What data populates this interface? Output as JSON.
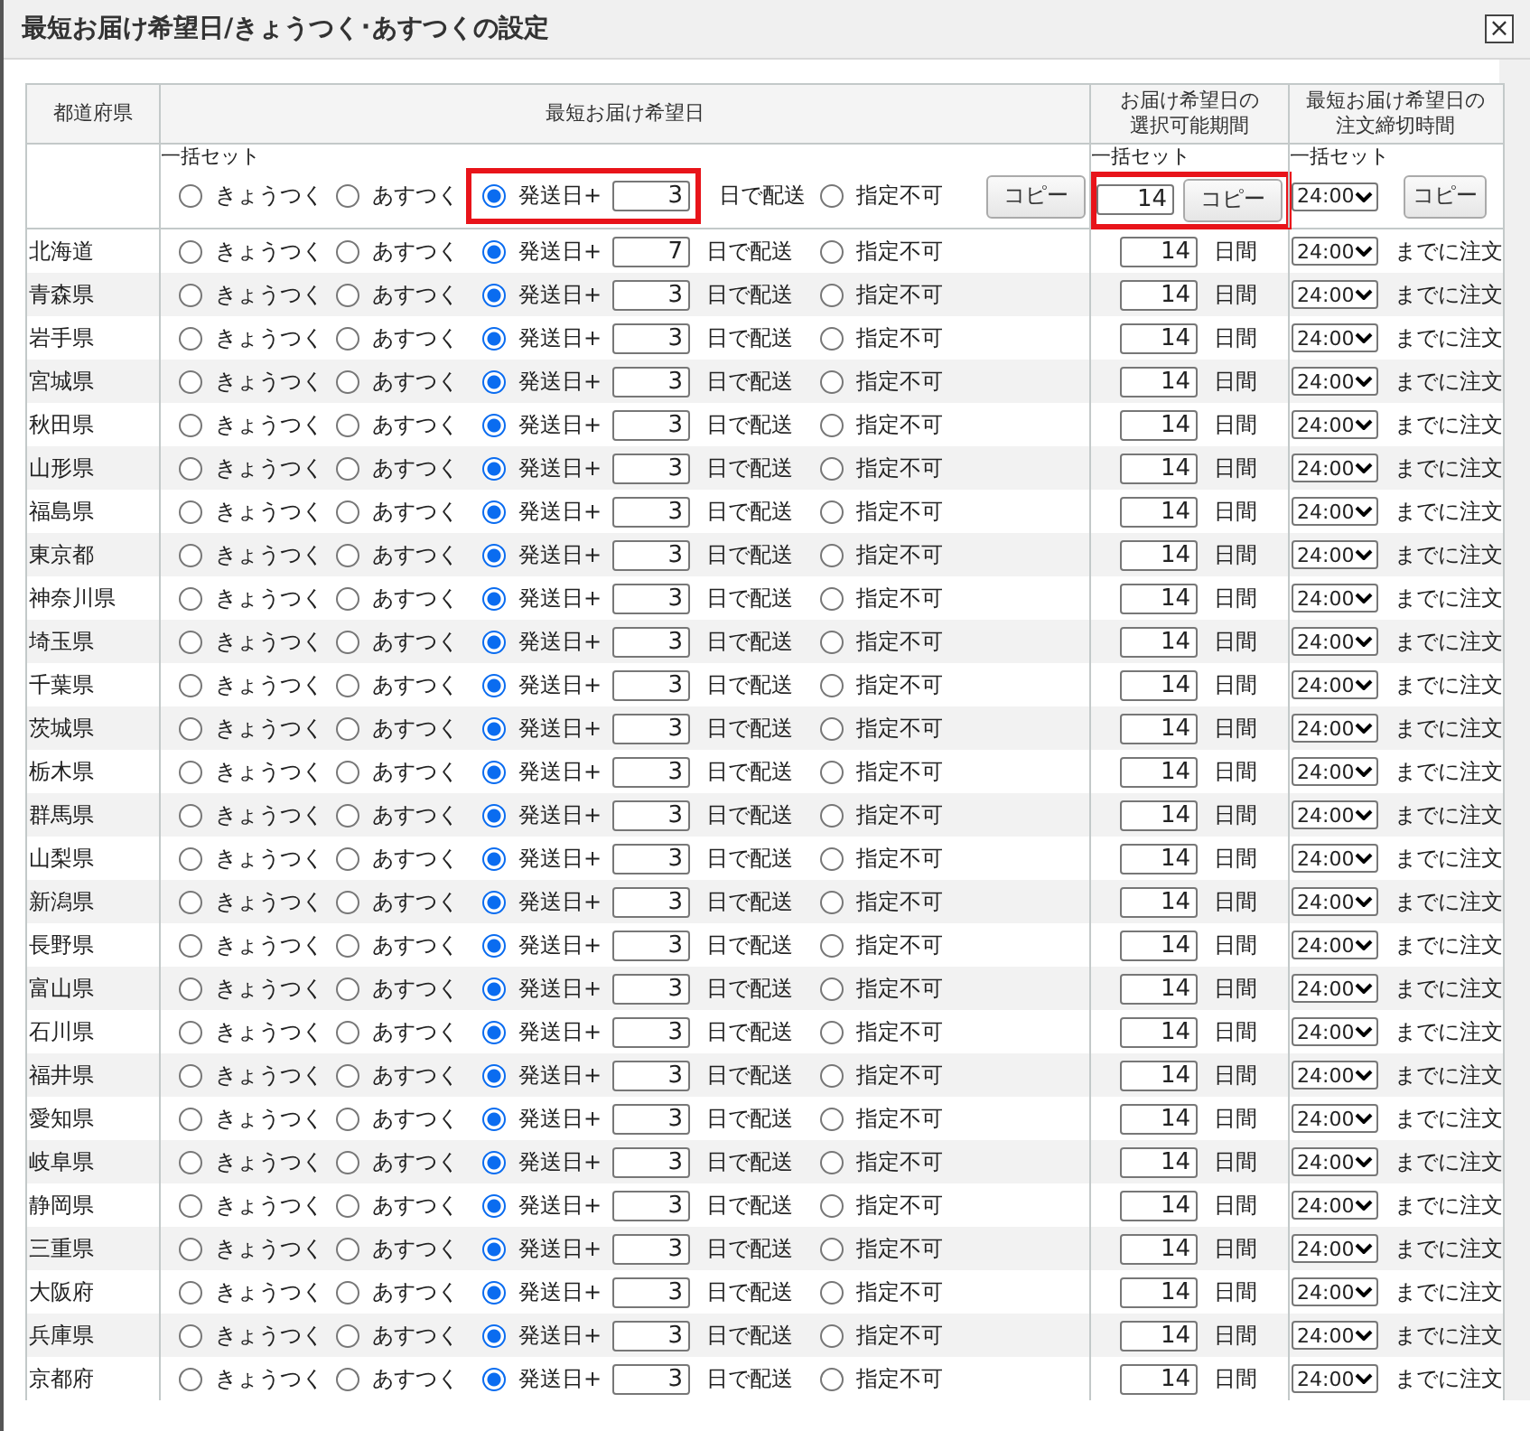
{
  "window": {
    "title": "最短お届け希望日/きょうつく･あすつくの設定",
    "close": "×"
  },
  "table": {
    "columns": [
      "都道府県",
      "最短お届け希望日",
      "お届け希望日の選択可能期間",
      "最短お届け希望日の注文締切時間"
    ],
    "bulk": {
      "label": "一括セット",
      "options": [
        {
          "label": "きょうつく",
          "selected": false
        },
        {
          "label": "あすつく",
          "selected": false
        },
        {
          "label": "発送日+",
          "selected": true,
          "highlighted": true
        },
        {
          "label": "指定不可",
          "selected": false
        }
      ],
      "days": "3",
      "days_unit": "日で配送",
      "copy": "コピー",
      "period_label": "一括セット",
      "period": "14",
      "period_copy": "コピー",
      "period_highlighted": true,
      "cutoff_label": "一括セット",
      "cutoff": "24:00",
      "cutoff_copy": "コピー"
    },
    "rows": [
      {
        "prefecture": "北海道",
        "options": [
          {
            "label": "きょうつく",
            "selected": false
          },
          {
            "label": "あすつく",
            "selected": false
          },
          {
            "label": "発送日+",
            "selected": true
          },
          {
            "label": "指定不可",
            "selected": false
          }
        ],
        "days": "7",
        "days_unit": "日で配送",
        "period": "14",
        "period_unit": "日間",
        "cutoff": "24:00",
        "cutoff_note": "までに注文"
      },
      {
        "prefecture": "青森県",
        "options": [
          {
            "label": "きょうつく",
            "selected": false
          },
          {
            "label": "あすつく",
            "selected": false
          },
          {
            "label": "発送日+",
            "selected": true
          },
          {
            "label": "指定不可",
            "selected": false
          }
        ],
        "days": "3",
        "days_unit": "日で配送",
        "period": "14",
        "period_unit": "日間",
        "cutoff": "24:00",
        "cutoff_note": "までに注文"
      },
      {
        "prefecture": "岩手県",
        "options": [
          {
            "label": "きょうつく",
            "selected": false
          },
          {
            "label": "あすつく",
            "selected": false
          },
          {
            "label": "発送日+",
            "selected": true
          },
          {
            "label": "指定不可",
            "selected": false
          }
        ],
        "days": "3",
        "days_unit": "日で配送",
        "period": "14",
        "period_unit": "日間",
        "cutoff": "24:00",
        "cutoff_note": "までに注文"
      },
      {
        "prefecture": "宮城県",
        "options": [
          {
            "label": "きょうつく",
            "selected": false
          },
          {
            "label": "あすつく",
            "selected": false
          },
          {
            "label": "発送日+",
            "selected": true
          },
          {
            "label": "指定不可",
            "selected": false
          }
        ],
        "days": "3",
        "days_unit": "日で配送",
        "period": "14",
        "period_unit": "日間",
        "cutoff": "24:00",
        "cutoff_note": "までに注文"
      },
      {
        "prefecture": "秋田県",
        "options": [
          {
            "label": "きょうつく",
            "selected": false
          },
          {
            "label": "あすつく",
            "selected": false
          },
          {
            "label": "発送日+",
            "selected": true
          },
          {
            "label": "指定不可",
            "selected": false
          }
        ],
        "days": "3",
        "days_unit": "日で配送",
        "period": "14",
        "period_unit": "日間",
        "cutoff": "24:00",
        "cutoff_note": "までに注文"
      },
      {
        "prefecture": "山形県",
        "options": [
          {
            "label": "きょうつく",
            "selected": false
          },
          {
            "label": "あすつく",
            "selected": false
          },
          {
            "label": "発送日+",
            "selected": true
          },
          {
            "label": "指定不可",
            "selected": false
          }
        ],
        "days": "3",
        "days_unit": "日で配送",
        "period": "14",
        "period_unit": "日間",
        "cutoff": "24:00",
        "cutoff_note": "までに注文"
      },
      {
        "prefecture": "福島県",
        "options": [
          {
            "label": "きょうつく",
            "selected": false
          },
          {
            "label": "あすつく",
            "selected": false
          },
          {
            "label": "発送日+",
            "selected": true
          },
          {
            "label": "指定不可",
            "selected": false
          }
        ],
        "days": "3",
        "days_unit": "日で配送",
        "period": "14",
        "period_unit": "日間",
        "cutoff": "24:00",
        "cutoff_note": "までに注文"
      },
      {
        "prefecture": "東京都",
        "options": [
          {
            "label": "きょうつく",
            "selected": false
          },
          {
            "label": "あすつく",
            "selected": false
          },
          {
            "label": "発送日+",
            "selected": true
          },
          {
            "label": "指定不可",
            "selected": false
          }
        ],
        "days": "3",
        "days_unit": "日で配送",
        "period": "14",
        "period_unit": "日間",
        "cutoff": "24:00",
        "cutoff_note": "までに注文"
      },
      {
        "prefecture": "神奈川県",
        "options": [
          {
            "label": "きょうつく",
            "selected": false
          },
          {
            "label": "あすつく",
            "selected": false
          },
          {
            "label": "発送日+",
            "selected": true
          },
          {
            "label": "指定不可",
            "selected": false
          }
        ],
        "days": "3",
        "days_unit": "日で配送",
        "period": "14",
        "period_unit": "日間",
        "cutoff": "24:00",
        "cutoff_note": "までに注文"
      },
      {
        "prefecture": "埼玉県",
        "options": [
          {
            "label": "きょうつく",
            "selected": false
          },
          {
            "label": "あすつく",
            "selected": false
          },
          {
            "label": "発送日+",
            "selected": true
          },
          {
            "label": "指定不可",
            "selected": false
          }
        ],
        "days": "3",
        "days_unit": "日で配送",
        "period": "14",
        "period_unit": "日間",
        "cutoff": "24:00",
        "cutoff_note": "までに注文"
      },
      {
        "prefecture": "千葉県",
        "options": [
          {
            "label": "きょうつく",
            "selected": false
          },
          {
            "label": "あすつく",
            "selected": false
          },
          {
            "label": "発送日+",
            "selected": true
          },
          {
            "label": "指定不可",
            "selected": false
          }
        ],
        "days": "3",
        "days_unit": "日で配送",
        "period": "14",
        "period_unit": "日間",
        "cutoff": "24:00",
        "cutoff_note": "までに注文"
      },
      {
        "prefecture": "茨城県",
        "options": [
          {
            "label": "きょうつく",
            "selected": false
          },
          {
            "label": "あすつく",
            "selected": false
          },
          {
            "label": "発送日+",
            "selected": true
          },
          {
            "label": "指定不可",
            "selected": false
          }
        ],
        "days": "3",
        "days_unit": "日で配送",
        "period": "14",
        "period_unit": "日間",
        "cutoff": "24:00",
        "cutoff_note": "までに注文"
      },
      {
        "prefecture": "栃木県",
        "options": [
          {
            "label": "きょうつく",
            "selected": false
          },
          {
            "label": "あすつく",
            "selected": false
          },
          {
            "label": "発送日+",
            "selected": true
          },
          {
            "label": "指定不可",
            "selected": false
          }
        ],
        "days": "3",
        "days_unit": "日で配送",
        "period": "14",
        "period_unit": "日間",
        "cutoff": "24:00",
        "cutoff_note": "までに注文"
      },
      {
        "prefecture": "群馬県",
        "options": [
          {
            "label": "きょうつく",
            "selected": false
          },
          {
            "label": "あすつく",
            "selected": false
          },
          {
            "label": "発送日+",
            "selected": true
          },
          {
            "label": "指定不可",
            "selected": false
          }
        ],
        "days": "3",
        "days_unit": "日で配送",
        "period": "14",
        "period_unit": "日間",
        "cutoff": "24:00",
        "cutoff_note": "までに注文"
      },
      {
        "prefecture": "山梨県",
        "options": [
          {
            "label": "きょうつく",
            "selected": false
          },
          {
            "label": "あすつく",
            "selected": false
          },
          {
            "label": "発送日+",
            "selected": true
          },
          {
            "label": "指定不可",
            "selected": false
          }
        ],
        "days": "3",
        "days_unit": "日で配送",
        "period": "14",
        "period_unit": "日間",
        "cutoff": "24:00",
        "cutoff_note": "までに注文"
      },
      {
        "prefecture": "新潟県",
        "options": [
          {
            "label": "きょうつく",
            "selected": false
          },
          {
            "label": "あすつく",
            "selected": false
          },
          {
            "label": "発送日+",
            "selected": true
          },
          {
            "label": "指定不可",
            "selected": false
          }
        ],
        "days": "3",
        "days_unit": "日で配送",
        "period": "14",
        "period_unit": "日間",
        "cutoff": "24:00",
        "cutoff_note": "までに注文"
      },
      {
        "prefecture": "長野県",
        "options": [
          {
            "label": "きょうつく",
            "selected": false
          },
          {
            "label": "あすつく",
            "selected": false
          },
          {
            "label": "発送日+",
            "selected": true
          },
          {
            "label": "指定不可",
            "selected": false
          }
        ],
        "days": "3",
        "days_unit": "日で配送",
        "period": "14",
        "period_unit": "日間",
        "cutoff": "24:00",
        "cutoff_note": "までに注文"
      },
      {
        "prefecture": "富山県",
        "options": [
          {
            "label": "きょうつく",
            "selected": false
          },
          {
            "label": "あすつく",
            "selected": false
          },
          {
            "label": "発送日+",
            "selected": true
          },
          {
            "label": "指定不可",
            "selected": false
          }
        ],
        "days": "3",
        "days_unit": "日で配送",
        "period": "14",
        "period_unit": "日間",
        "cutoff": "24:00",
        "cutoff_note": "までに注文"
      },
      {
        "prefecture": "石川県",
        "options": [
          {
            "label": "きょうつく",
            "selected": false
          },
          {
            "label": "あすつく",
            "selected": false
          },
          {
            "label": "発送日+",
            "selected": true
          },
          {
            "label": "指定不可",
            "selected": false
          }
        ],
        "days": "3",
        "days_unit": "日で配送",
        "period": "14",
        "period_unit": "日間",
        "cutoff": "24:00",
        "cutoff_note": "までに注文"
      },
      {
        "prefecture": "福井県",
        "options": [
          {
            "label": "きょうつく",
            "selected": false
          },
          {
            "label": "あすつく",
            "selected": false
          },
          {
            "label": "発送日+",
            "selected": true
          },
          {
            "label": "指定不可",
            "selected": false
          }
        ],
        "days": "3",
        "days_unit": "日で配送",
        "period": "14",
        "period_unit": "日間",
        "cutoff": "24:00",
        "cutoff_note": "までに注文"
      },
      {
        "prefecture": "愛知県",
        "options": [
          {
            "label": "きょうつく",
            "selected": false
          },
          {
            "label": "あすつく",
            "selected": false
          },
          {
            "label": "発送日+",
            "selected": true
          },
          {
            "label": "指定不可",
            "selected": false
          }
        ],
        "days": "3",
        "days_unit": "日で配送",
        "period": "14",
        "period_unit": "日間",
        "cutoff": "24:00",
        "cutoff_note": "までに注文"
      },
      {
        "prefecture": "岐阜県",
        "options": [
          {
            "label": "きょうつく",
            "selected": false
          },
          {
            "label": "あすつく",
            "selected": false
          },
          {
            "label": "発送日+",
            "selected": true
          },
          {
            "label": "指定不可",
            "selected": false
          }
        ],
        "days": "3",
        "days_unit": "日で配送",
        "period": "14",
        "period_unit": "日間",
        "cutoff": "24:00",
        "cutoff_note": "までに注文"
      },
      {
        "prefecture": "静岡県",
        "options": [
          {
            "label": "きょうつく",
            "selected": false
          },
          {
            "label": "あすつく",
            "selected": false
          },
          {
            "label": "発送日+",
            "selected": true
          },
          {
            "label": "指定不可",
            "selected": false
          }
        ],
        "days": "3",
        "days_unit": "日で配送",
        "period": "14",
        "period_unit": "日間",
        "cutoff": "24:00",
        "cutoff_note": "までに注文"
      },
      {
        "prefecture": "三重県",
        "options": [
          {
            "label": "きょうつく",
            "selected": false
          },
          {
            "label": "あすつく",
            "selected": false
          },
          {
            "label": "発送日+",
            "selected": true
          },
          {
            "label": "指定不可",
            "selected": false
          }
        ],
        "days": "3",
        "days_unit": "日で配送",
        "period": "14",
        "period_unit": "日間",
        "cutoff": "24:00",
        "cutoff_note": "までに注文"
      },
      {
        "prefecture": "大阪府",
        "options": [
          {
            "label": "きょうつく",
            "selected": false
          },
          {
            "label": "あすつく",
            "selected": false
          },
          {
            "label": "発送日+",
            "selected": true
          },
          {
            "label": "指定不可",
            "selected": false
          }
        ],
        "days": "3",
        "days_unit": "日で配送",
        "period": "14",
        "period_unit": "日間",
        "cutoff": "24:00",
        "cutoff_note": "までに注文"
      },
      {
        "prefecture": "兵庫県",
        "options": [
          {
            "label": "きょうつく",
            "selected": false
          },
          {
            "label": "あすつく",
            "selected": false
          },
          {
            "label": "発送日+",
            "selected": true
          },
          {
            "label": "指定不可",
            "selected": false
          }
        ],
        "days": "3",
        "days_unit": "日で配送",
        "period": "14",
        "period_unit": "日間",
        "cutoff": "24:00",
        "cutoff_note": "までに注文"
      },
      {
        "prefecture": "京都府",
        "options": [
          {
            "label": "きょうつく",
            "selected": false
          },
          {
            "label": "あすつく",
            "selected": false
          },
          {
            "label": "発送日+",
            "selected": true
          },
          {
            "label": "指定不可",
            "selected": false
          }
        ],
        "days": "3",
        "days_unit": "日で配送",
        "period": "14",
        "period_unit": "日間",
        "cutoff": "24:00",
        "cutoff_note": "までに注文"
      }
    ]
  }
}
